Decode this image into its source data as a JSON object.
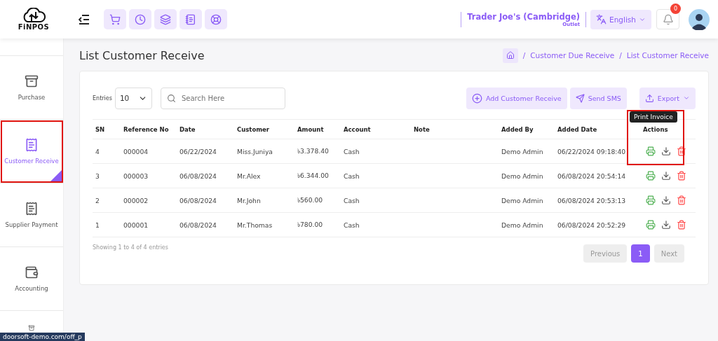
{
  "brand": {
    "name": "FiNPOS"
  },
  "header": {
    "store_name": "Trader Joe's (Cambridge)",
    "store_type": "Outlet",
    "language": "English",
    "notification_count": "0"
  },
  "sidebar": {
    "items": [
      {
        "label": "Purchase",
        "selected": false
      },
      {
        "label": "Customer Receive",
        "selected": true
      },
      {
        "label": "Supplier Payment",
        "selected": false
      },
      {
        "label": "Accounting",
        "selected": false
      }
    ]
  },
  "page": {
    "title": "List Customer Receive",
    "breadcrumb": [
      {
        "kind": "separator",
        "text": "/"
      },
      {
        "kind": "link",
        "text": "Customer Due Receive"
      },
      {
        "kind": "separator",
        "text": "/"
      },
      {
        "kind": "link",
        "text": "List Customer Receive"
      }
    ]
  },
  "toolbar": {
    "entries_label": "Entries",
    "entries_value": "10",
    "search_placeholder": "Search Here",
    "buttons": [
      "Add Customer Receive",
      "Send SMS",
      "Export"
    ]
  },
  "table": {
    "columns": [
      "SN",
      "Reference No",
      "Date",
      "Customer",
      "Amount",
      "Account",
      "Note",
      "Added By",
      "Added Date",
      "Actions"
    ],
    "rows": [
      [
        "4",
        "000004",
        "06/22/2024",
        "Miss.Juniya",
        "৳3.378.40",
        "Cash",
        "",
        "Demo Admin",
        "06/22/2024 09:18:40"
      ],
      [
        "3",
        "000003",
        "06/08/2024",
        "Mr.Alex",
        "৳6.344.00",
        "Cash",
        "",
        "Demo Admin",
        "06/08/2024 20:54:14"
      ],
      [
        "2",
        "000002",
        "06/08/2024",
        "Mr.John",
        "৳560.00",
        "Cash",
        "",
        "Demo Admin",
        "06/08/2024 20:53:13"
      ],
      [
        "1",
        "000001",
        "06/08/2024",
        "Mr.Thomas",
        "৳780.00",
        "Cash",
        "",
        "Demo Admin",
        "06/08/2024 20:52:29"
      ]
    ],
    "tooltip": "Print Invoice"
  },
  "footer": {
    "info": "Showing 1 to 4 of 4 entries",
    "pages": [
      {
        "label": "Previous",
        "selected": false
      },
      {
        "label": "1",
        "selected": true
      },
      {
        "label": "Next",
        "selected": false
      }
    ]
  },
  "status_bar": {
    "url": "doorsoft-demo.com/off_p"
  }
}
